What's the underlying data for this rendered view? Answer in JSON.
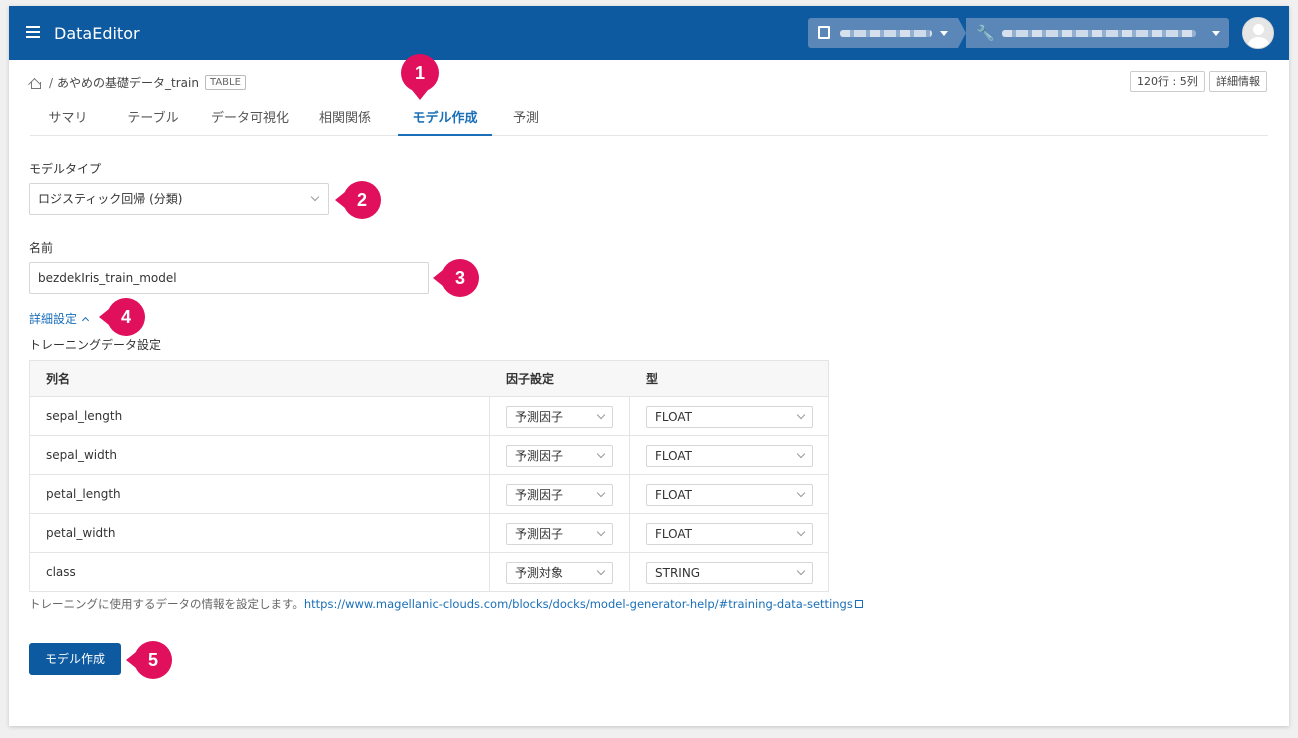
{
  "header": {
    "app_title": "DataEditor",
    "menu_icon": "hamburger-menu-icon",
    "org_icon": "building-icon",
    "project_icon": "wrench-icon",
    "avatar_icon": "user-avatar-icon"
  },
  "breadcrumb": {
    "home_icon": "home-icon",
    "separator": "/",
    "dataset": "あやめの基礎データ_train",
    "badge": "TABLE"
  },
  "toolbar": {
    "rows_cols": "120行 : 5列",
    "info_label": "詳細情報"
  },
  "tabs": [
    {
      "label": "サマリ"
    },
    {
      "label": "テーブル"
    },
    {
      "label": "データ可視化"
    },
    {
      "label": "相関関係"
    },
    {
      "label": "モデル作成",
      "active": true
    },
    {
      "label": "予測"
    }
  ],
  "form": {
    "model_type_label": "モデルタイプ",
    "model_type_value": "ロジスティック回帰 (分類)",
    "name_label": "名前",
    "name_value": "bezdekIris_train_model",
    "advanced_label": "詳細設定",
    "training_label": "トレーニングデータ設定"
  },
  "training_table": {
    "headers": [
      "列名",
      "因子設定",
      "型"
    ],
    "rows": [
      {
        "column": "sepal_length",
        "factor": "予測因子",
        "type": "FLOAT"
      },
      {
        "column": "sepal_width",
        "factor": "予測因子",
        "type": "FLOAT"
      },
      {
        "column": "petal_length",
        "factor": "予測因子",
        "type": "FLOAT"
      },
      {
        "column": "petal_width",
        "factor": "予測因子",
        "type": "FLOAT"
      },
      {
        "column": "class",
        "factor": "予測対象",
        "type": "STRING"
      }
    ]
  },
  "help": {
    "text": "トレーニングに使用するデータの情報を設定します。",
    "link": "https://www.magellanic-clouds.com/blocks/docks/model-generator-help/#training-data-settings"
  },
  "actions": {
    "create_label": "モデル作成"
  },
  "annotations": {
    "marker_color": "#e0105c",
    "labels": [
      "1",
      "2",
      "3",
      "4",
      "5"
    ]
  },
  "colors": {
    "brand": "#0d5aa1",
    "accent": "#1a6fb8"
  }
}
